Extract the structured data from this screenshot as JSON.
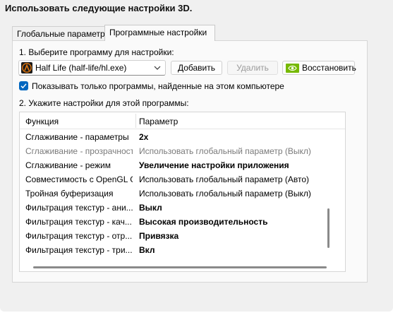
{
  "heading": "Использовать следующие настройки 3D.",
  "tabs": [
    {
      "label": "Глобальные параметры",
      "active": false
    },
    {
      "label": "Программные настройки",
      "active": true
    }
  ],
  "step1": {
    "label": "1. Выберите программу для настройки:",
    "selected_program": "Half Life (half-life/hl.exe)",
    "program_icon": "half-life-lambda-icon",
    "buttons": {
      "add": "Добавить",
      "delete": "Удалить",
      "restore": "Восстановить"
    },
    "delete_disabled": true
  },
  "filter": {
    "label": "Показывать только программы, найденные на этом компьютере",
    "checked": true
  },
  "step2": {
    "label": "2. Укажите настройки для этой программы:",
    "columns": [
      "Функция",
      "Параметр"
    ],
    "rows": [
      {
        "function": "Сглаживание - параметры",
        "value": "2х",
        "style": "bold"
      },
      {
        "function": "Сглаживание - прозрачность",
        "value": "Использовать глобальный параметр (Выкл)",
        "style": "dim"
      },
      {
        "function": "Сглаживание - режим",
        "value": "Увеличение настройки приложения",
        "style": "bold"
      },
      {
        "function": "Совместимость с OpenGL GDI",
        "value": "Использовать глобальный параметр (Авто)",
        "style": "normal"
      },
      {
        "function": "Тройная буферизация",
        "value": "Использовать глобальный параметр (Выкл)",
        "style": "normal"
      },
      {
        "function": "Фильтрация текстур - ани...",
        "value": "Выкл",
        "style": "bold"
      },
      {
        "function": "Фильтрация текстур - кач...",
        "value": "Высокая производительность",
        "style": "bold"
      },
      {
        "function": "Фильтрация текстур - отр...",
        "value": "Привязка",
        "style": "bold"
      },
      {
        "function": "Фильтрация текстур - три...",
        "value": "Вкл",
        "style": "bold"
      }
    ]
  },
  "colors": {
    "accent": "#0067c0",
    "nvidia_green": "#76b900"
  }
}
